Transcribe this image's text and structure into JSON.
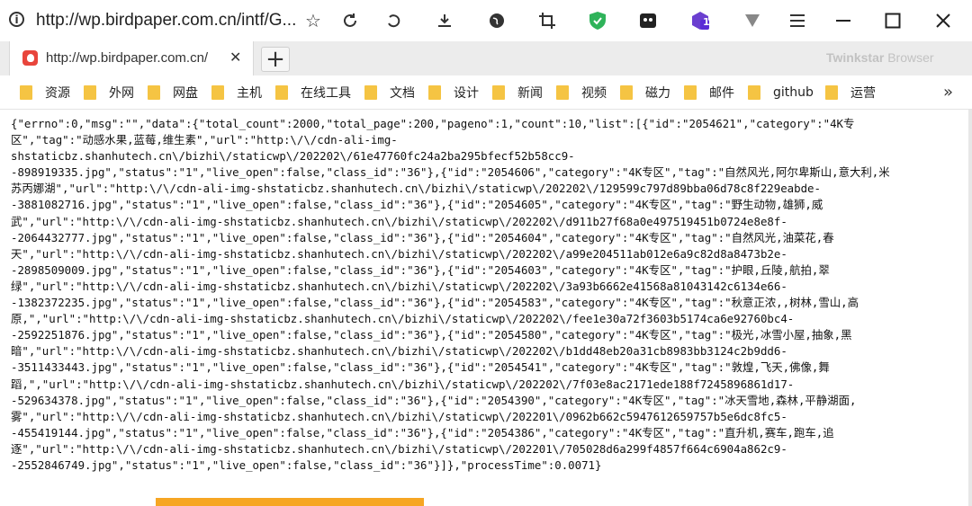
{
  "toolbar": {
    "url": "http://wp.birdpaper.com.cn/intf/G...",
    "icons": [
      "info-icon",
      "star-icon",
      "reload-icon",
      "undo-icon",
      "download-icon",
      "globe-icon",
      "crop-icon",
      "shield-icon",
      "extension-icon",
      "notification-icon",
      "filter-icon",
      "menu-icon"
    ],
    "notification_count": "1"
  },
  "window": {
    "minimize": "—",
    "maximize": "☐",
    "close": "✕"
  },
  "tab": {
    "title": "http://wp.birdpaper.com.cn/",
    "close": "✕",
    "new_tab": "+"
  },
  "brand": {
    "name": "Twinkstar",
    "suffix": " Browser"
  },
  "bookmarks": {
    "items": [
      {
        "label": "资源"
      },
      {
        "label": "外网"
      },
      {
        "label": "网盘"
      },
      {
        "label": "主机"
      },
      {
        "label": "在线工具"
      },
      {
        "label": "文档"
      },
      {
        "label": "设计"
      },
      {
        "label": "新闻"
      },
      {
        "label": "视频"
      },
      {
        "label": "磁力"
      },
      {
        "label": "邮件"
      },
      {
        "label": "github"
      },
      {
        "label": "运营"
      }
    ],
    "more": "»"
  },
  "content": {
    "json_text": "{\"errno\":0,\"msg\":\"\",\"data\":{\"total_count\":2000,\"total_page\":200,\"pageno\":1,\"count\":10,\"list\":[{\"id\":\"2054621\",\"category\":\"4K专\n区\",\"tag\":\"动感水果,蓝莓,维生素\",\"url\":\"http:\\/\\/cdn-ali-img-\nshstaticbz.shanhutech.cn\\/bizhi\\/staticwp\\/202202\\/61e47760fc24a2ba295bfecf52b58cc9-\n-898919335.jpg\",\"status\":\"1\",\"live_open\":false,\"class_id\":\"36\"},{\"id\":\"2054606\",\"category\":\"4K专区\",\"tag\":\"自然风光,阿尔卑斯山,意大利,米\n苏丙娜湖\",\"url\":\"http:\\/\\/cdn-ali-img-shstaticbz.shanhutech.cn\\/bizhi\\/staticwp\\/202202\\/129599c797d89bba06d78c8f229eabde-\n-3881082716.jpg\",\"status\":\"1\",\"live_open\":false,\"class_id\":\"36\"},{\"id\":\"2054605\",\"category\":\"4K专区\",\"tag\":\"野生动物,雄狮,威\n武\",\"url\":\"http:\\/\\/cdn-ali-img-shstaticbz.shanhutech.cn\\/bizhi\\/staticwp\\/202202\\/d911b27f68a0e497519451b0724e8e8f-\n-2064432777.jpg\",\"status\":\"1\",\"live_open\":false,\"class_id\":\"36\"},{\"id\":\"2054604\",\"category\":\"4K专区\",\"tag\":\"自然风光,油菜花,春\n天\",\"url\":\"http:\\/\\/cdn-ali-img-shstaticbz.shanhutech.cn\\/bizhi\\/staticwp\\/202202\\/a99e204511ab012e6a9c82d8a8473b2e-\n-2898509009.jpg\",\"status\":\"1\",\"live_open\":false,\"class_id\":\"36\"},{\"id\":\"2054603\",\"category\":\"4K专区\",\"tag\":\"护眼,丘陵,航拍,翠\n绿\",\"url\":\"http:\\/\\/cdn-ali-img-shstaticbz.shanhutech.cn\\/bizhi\\/staticwp\\/202202\\/3a93b6662e41568a81043142c6134e66-\n-1382372235.jpg\",\"status\":\"1\",\"live_open\":false,\"class_id\":\"36\"},{\"id\":\"2054583\",\"category\":\"4K专区\",\"tag\":\"秋意正浓,,树林,雪山,高\n原,\",\"url\":\"http:\\/\\/cdn-ali-img-shstaticbz.shanhutech.cn\\/bizhi\\/staticwp\\/202202\\/fee1e30a72f3603b5174ca6e92760bc4-\n-2592251876.jpg\",\"status\":\"1\",\"live_open\":false,\"class_id\":\"36\"},{\"id\":\"2054580\",\"category\":\"4K专区\",\"tag\":\"极光,冰雪小屋,抽象,黑\n暗\",\"url\":\"http:\\/\\/cdn-ali-img-shstaticbz.shanhutech.cn\\/bizhi\\/staticwp\\/202202\\/b1dd48eb20a31cb8983bb3124c2b9dd6-\n-3511433443.jpg\",\"status\":\"1\",\"live_open\":false,\"class_id\":\"36\"},{\"id\":\"2054541\",\"category\":\"4K专区\",\"tag\":\"敦煌,飞天,佛像,舞\n蹈,\",\"url\":\"http:\\/\\/cdn-ali-img-shstaticbz.shanhutech.cn\\/bizhi\\/staticwp\\/202202\\/7f03e8ac2171ede188f7245896861d17-\n-529634378.jpg\",\"status\":\"1\",\"live_open\":false,\"class_id\":\"36\"},{\"id\":\"2054390\",\"category\":\"4K专区\",\"tag\":\"冰天雪地,森林,平静湖面,\n雾\",\"url\":\"http:\\/\\/cdn-ali-img-shstaticbz.shanhutech.cn\\/bizhi\\/staticwp\\/202201\\/0962b662c5947612659757b5e6dc8fc5-\n-455419144.jpg\",\"status\":\"1\",\"live_open\":false,\"class_id\":\"36\"},{\"id\":\"2054386\",\"category\":\"4K专区\",\"tag\":\"直升机,赛车,跑车,追\n逐\",\"url\":\"http:\\/\\/cdn-ali-img-shstaticbz.shanhutech.cn\\/bizhi\\/staticwp\\/202201\\/705028d6a299f4857f664c6904a862c9-\n-2552846749.jpg\",\"status\":\"1\",\"live_open\":false,\"class_id\":\"36\"}]},\"processTime\":0.0071}"
  }
}
